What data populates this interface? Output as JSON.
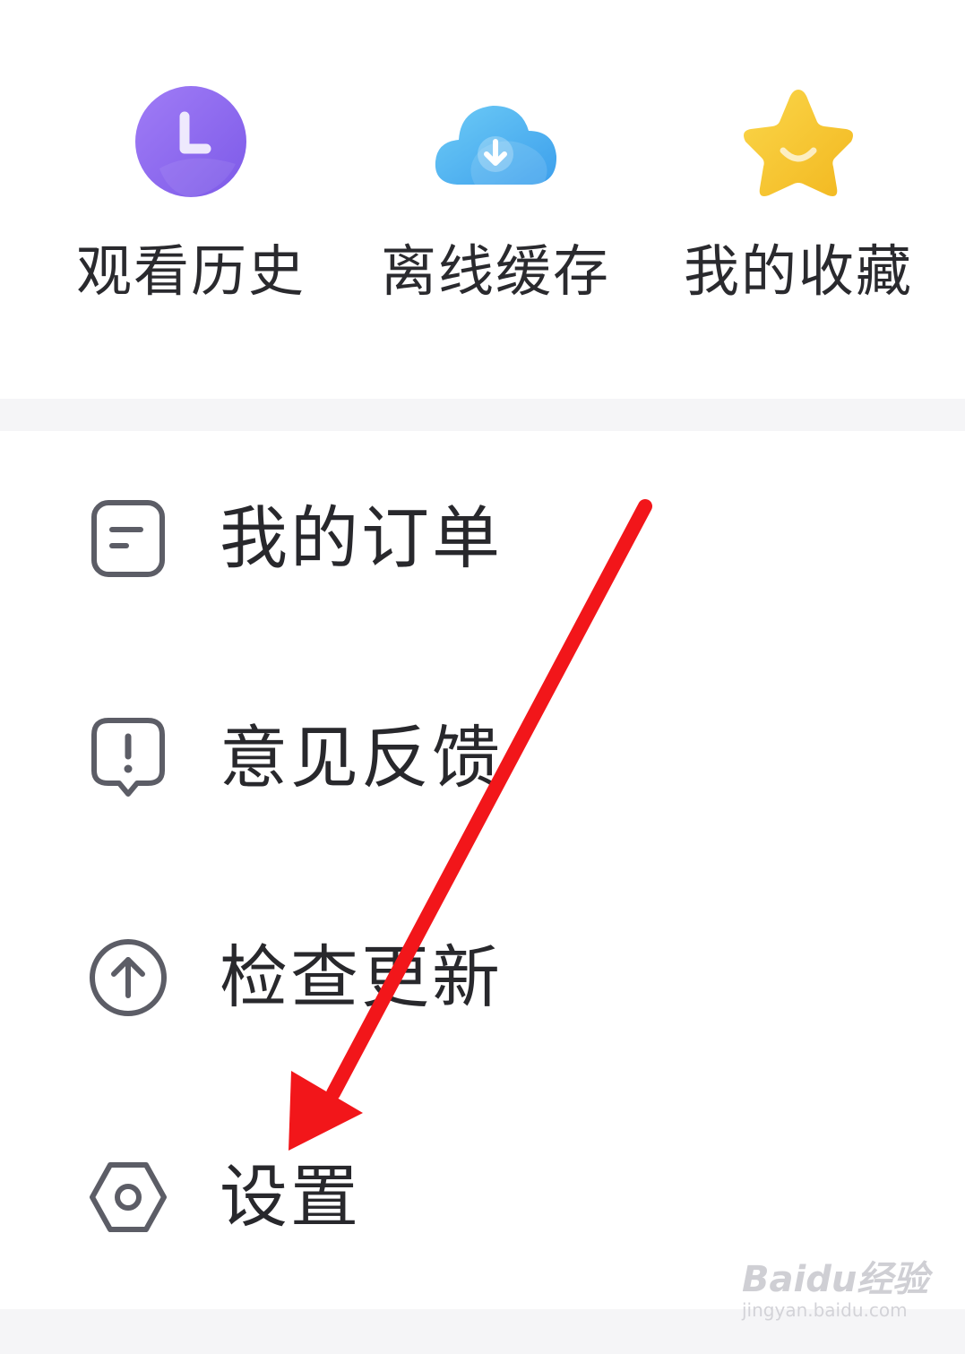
{
  "quick_actions": {
    "history": {
      "label": "观看历史",
      "icon": "clock-icon",
      "color": "#8b6cf0"
    },
    "offline": {
      "label": "离线缓存",
      "icon": "cloud-download-icon",
      "color": "#4fb6f0"
    },
    "favorite": {
      "label": "我的收藏",
      "icon": "star-icon",
      "color": "#f7c431"
    }
  },
  "menu": {
    "items": [
      {
        "label": "我的订单",
        "icon": "order-icon"
      },
      {
        "label": "意见反馈",
        "icon": "feedback-icon"
      },
      {
        "label": "检查更新",
        "icon": "upload-arrow-icon"
      },
      {
        "label": "设置",
        "icon": "settings-hexagon-icon"
      }
    ]
  },
  "annotation": {
    "color": "#f2161a",
    "icon": "red-arrow-icon"
  },
  "watermark": {
    "logo": "Baidu经验",
    "url": "jingyan.baidu.com"
  }
}
